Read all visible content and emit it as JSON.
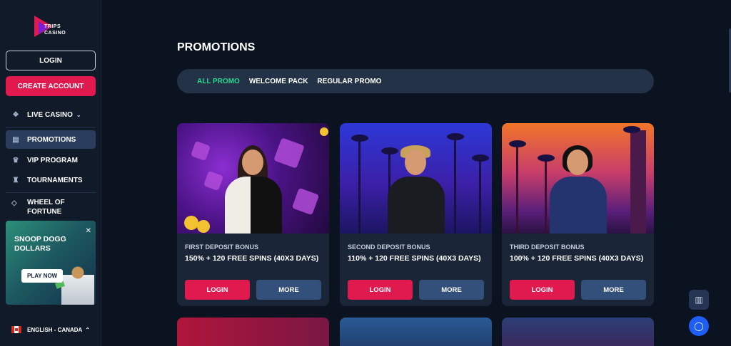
{
  "brand": {
    "line1": "TRIPS",
    "line2": "CASINO"
  },
  "sidebar": {
    "login_label": "LOGIN",
    "create_label": "CREATE ACCOUNT",
    "items": [
      {
        "label": "LIVE CASINO",
        "icon": "cards-icon"
      },
      {
        "label": "PROMOTIONS",
        "icon": "gift-icon",
        "active": true
      },
      {
        "label": "VIP PROGRAM",
        "icon": "crown-icon"
      },
      {
        "label": "TOURNAMENTS",
        "icon": "trophy-icon"
      },
      {
        "label": "WHEEL OF FORTUNE",
        "icon": "tag-icon"
      }
    ],
    "banner": {
      "title": "SNOOP DOGG DOLLARS",
      "cta": "PLAY NOW"
    },
    "language": "ENGLISH - CANADA"
  },
  "main": {
    "title": "PROMOTIONS",
    "tabs": [
      {
        "label": "ALL PROMO",
        "active": true
      },
      {
        "label": "WELCOME PACK"
      },
      {
        "label": "REGULAR PROMO"
      }
    ],
    "cards": [
      {
        "title": "FIRST DEPOSIT BONUS",
        "desc": "150% + 120 FREE SPINS (40X3 DAYS)",
        "login": "LOGIN",
        "more": "MORE"
      },
      {
        "title": "SECOND DEPOSIT BONUS",
        "desc": "110% + 120 FREE SPINS (40X3 DAYS)",
        "login": "LOGIN",
        "more": "MORE"
      },
      {
        "title": "THIRD DEPOSIT BONUS",
        "desc": "100% + 120 FREE SPINS (40X3 DAYS)",
        "login": "LOGIN",
        "more": "MORE"
      }
    ]
  },
  "colors": {
    "accent_red": "#e0194f",
    "accent_green": "#2bd692",
    "panel": "#1a2638",
    "background": "#0c1320"
  }
}
